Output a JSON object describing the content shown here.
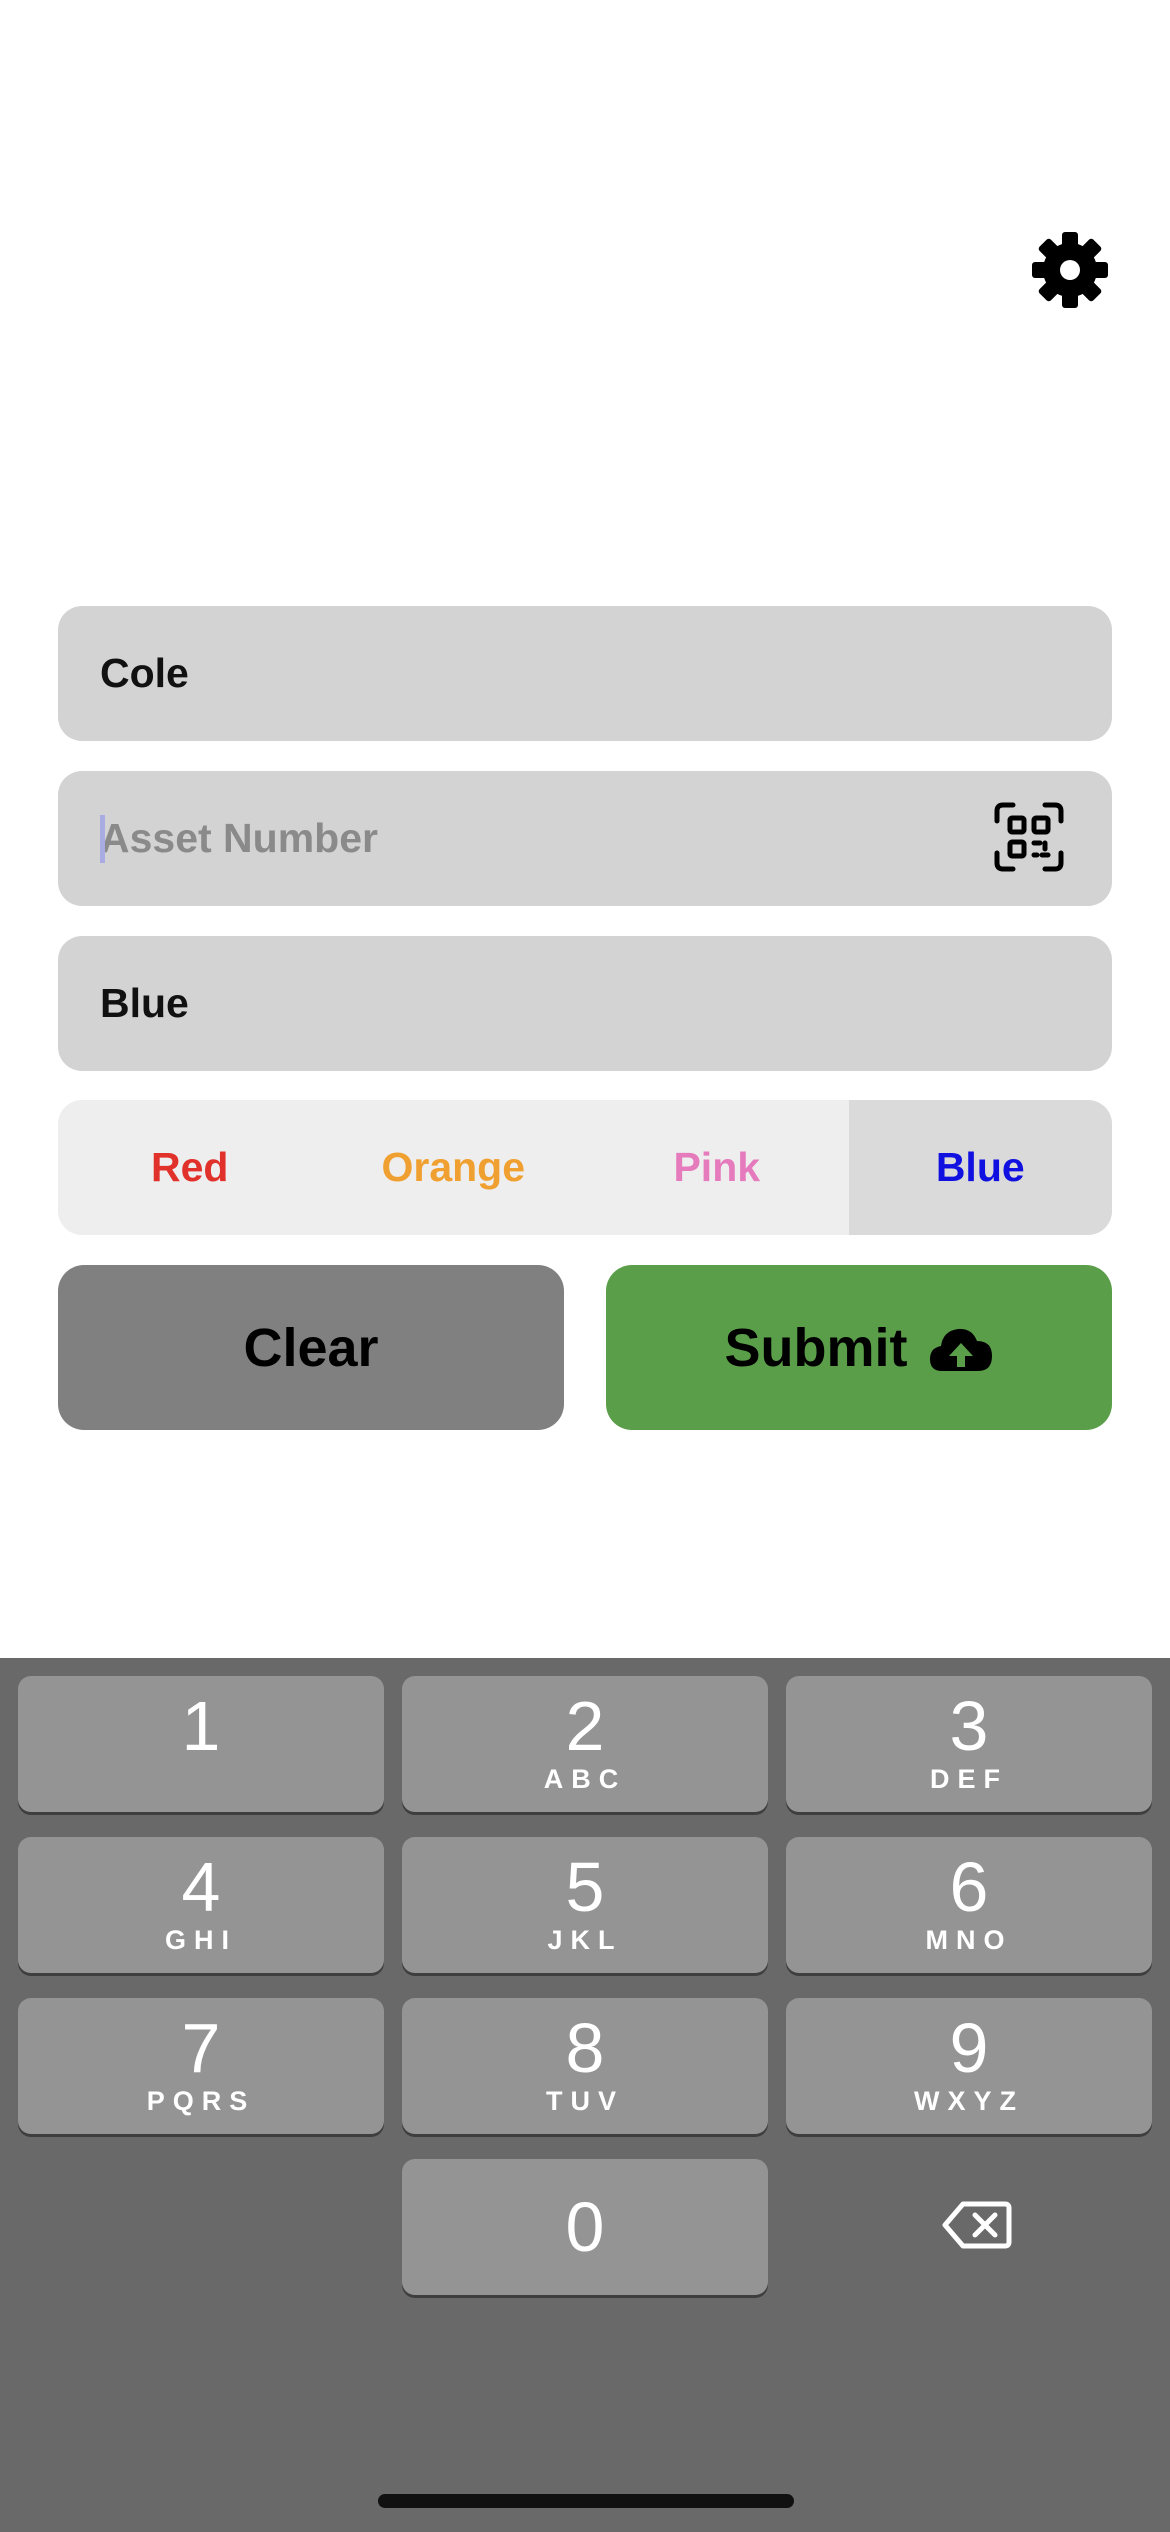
{
  "settings": {
    "icon": "gear-icon"
  },
  "form": {
    "name_value": "Cole",
    "asset_placeholder": "Asset Number",
    "asset_value": "",
    "scan_icon": "qr-scan-icon",
    "color_value": "Blue"
  },
  "color_picker": {
    "options": [
      {
        "label": "Red",
        "color": "#e0312b"
      },
      {
        "label": "Orange",
        "color": "#f0a030"
      },
      {
        "label": "Pink",
        "color": "#e57bbd"
      },
      {
        "label": "Blue",
        "color": "#1010e0"
      }
    ],
    "selected": "Blue"
  },
  "actions": {
    "clear_label": "Clear",
    "submit_label": "Submit",
    "submit_icon": "cloud-upload-icon",
    "clear_color": "#808080",
    "submit_color": "#5b9e4a"
  },
  "keypad": {
    "keys": [
      {
        "digit": "1",
        "letters": ""
      },
      {
        "digit": "2",
        "letters": "ABC"
      },
      {
        "digit": "3",
        "letters": "DEF"
      },
      {
        "digit": "4",
        "letters": "GHI"
      },
      {
        "digit": "5",
        "letters": "JKL"
      },
      {
        "digit": "6",
        "letters": "MNO"
      },
      {
        "digit": "7",
        "letters": "PQRS"
      },
      {
        "digit": "8",
        "letters": "TUV"
      },
      {
        "digit": "9",
        "letters": "WXYZ"
      },
      {
        "digit": "0",
        "letters": ""
      }
    ],
    "delete_icon": "backspace-icon"
  }
}
